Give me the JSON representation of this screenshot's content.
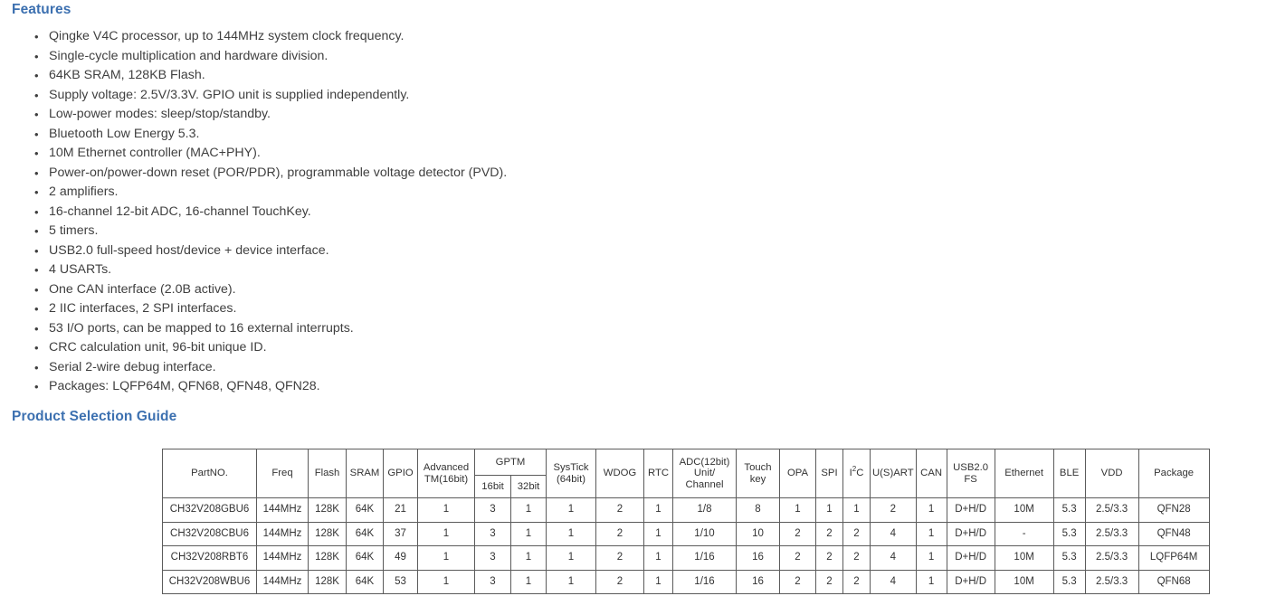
{
  "features": {
    "heading": "Features",
    "bullet_glyph": "•",
    "items": [
      "Qingke V4C processor, up to 144MHz system clock frequency.",
      "Single-cycle multiplication and hardware division.",
      "64KB SRAM, 128KB Flash.",
      "Supply voltage: 2.5V/3.3V. GPIO unit is supplied independently.",
      "Low-power modes: sleep/stop/standby.",
      "Bluetooth Low Energy 5.3.",
      "10M Ethernet controller (MAC+PHY).",
      "Power-on/power-down reset (POR/PDR), programmable voltage detector (PVD).",
      "2 amplifiers.",
      "16-channel 12-bit ADC, 16-channel TouchKey.",
      "5 timers.",
      "USB2.0 full-speed host/device + device interface.",
      "4 USARTs.",
      "One CAN interface (2.0B active).",
      "2 IIC interfaces, 2 SPI interfaces.",
      "53 I/O ports, can be mapped to 16 external interrupts.",
      "CRC calculation unit, 96-bit unique ID.",
      "Serial 2-wire debug interface.",
      "Packages: LQFP64M, QFN68, QFN48, QFN28."
    ]
  },
  "guide": {
    "heading": "Product Selection Guide",
    "headers": {
      "part": "PartNO.",
      "freq": "Freq",
      "flash": "Flash",
      "sram": "SRAM",
      "gpio": "GPIO",
      "advanced_tm_line1": "Advanced",
      "advanced_tm_line2": "TM(16bit)",
      "gptm": "GPTM",
      "gptm_16bit": "16bit",
      "gptm_32bit": "32bit",
      "systick_line1": "SysTick",
      "systick_line2": "(64bit)",
      "wdog": "WDOG",
      "rtc": "RTC",
      "adc_line1": "ADC(12bit)",
      "adc_line2": "Unit/",
      "adc_line3": "Channel",
      "touch_line1": "Touch",
      "touch_line2": "key",
      "opa": "OPA",
      "spi": "SPI",
      "i2c_pre": "I",
      "i2c_sup": "2",
      "i2c_post": "C",
      "usart": "U(S)ART",
      "can": "CAN",
      "usb_line1": "USB2.0",
      "usb_line2": "FS",
      "ethernet": "Ethernet",
      "ble": "BLE",
      "vdd": "VDD",
      "package": "Package"
    },
    "rows": [
      {
        "part": "CH32V208GBU6",
        "freq": "144MHz",
        "flash": "128K",
        "sram": "64K",
        "gpio": "21",
        "advanced_tm": "1",
        "gptm_16bit": "3",
        "gptm_32bit": "1",
        "systick": "1",
        "wdog": "2",
        "rtc": "1",
        "adc": "1/8",
        "touch_key": "8",
        "opa": "1",
        "spi": "1",
        "i2c": "1",
        "usart": "2",
        "can": "1",
        "usb": "D+H/D",
        "ethernet": "10M",
        "ble": "5.3",
        "vdd": "2.5/3.3",
        "package": "QFN28"
      },
      {
        "part": "CH32V208CBU6",
        "freq": "144MHz",
        "flash": "128K",
        "sram": "64K",
        "gpio": "37",
        "advanced_tm": "1",
        "gptm_16bit": "3",
        "gptm_32bit": "1",
        "systick": "1",
        "wdog": "2",
        "rtc": "1",
        "adc": "1/10",
        "touch_key": "10",
        "opa": "2",
        "spi": "2",
        "i2c": "2",
        "usart": "4",
        "can": "1",
        "usb": "D+H/D",
        "ethernet": "-",
        "ble": "5.3",
        "vdd": "2.5/3.3",
        "package": "QFN48"
      },
      {
        "part": "CH32V208RBT6",
        "freq": "144MHz",
        "flash": "128K",
        "sram": "64K",
        "gpio": "49",
        "advanced_tm": "1",
        "gptm_16bit": "3",
        "gptm_32bit": "1",
        "systick": "1",
        "wdog": "2",
        "rtc": "1",
        "adc": "1/16",
        "touch_key": "16",
        "opa": "2",
        "spi": "2",
        "i2c": "2",
        "usart": "4",
        "can": "1",
        "usb": "D+H/D",
        "ethernet": "10M",
        "ble": "5.3",
        "vdd": "2.5/3.3",
        "package": "LQFP64M"
      },
      {
        "part": "CH32V208WBU6",
        "freq": "144MHz",
        "flash": "128K",
        "sram": "64K",
        "gpio": "53",
        "advanced_tm": "1",
        "gptm_16bit": "3",
        "gptm_32bit": "1",
        "systick": "1",
        "wdog": "2",
        "rtc": "1",
        "adc": "1/16",
        "touch_key": "16",
        "opa": "2",
        "spi": "2",
        "i2c": "2",
        "usart": "4",
        "can": "1",
        "usb": "D+H/D",
        "ethernet": "10M",
        "ble": "5.3",
        "vdd": "2.5/3.3",
        "package": "QFN68"
      }
    ]
  },
  "colors": {
    "heading_blue": "#3c70b0",
    "body_text": "#3f3f3f",
    "table_border": "#5b5b5b"
  }
}
